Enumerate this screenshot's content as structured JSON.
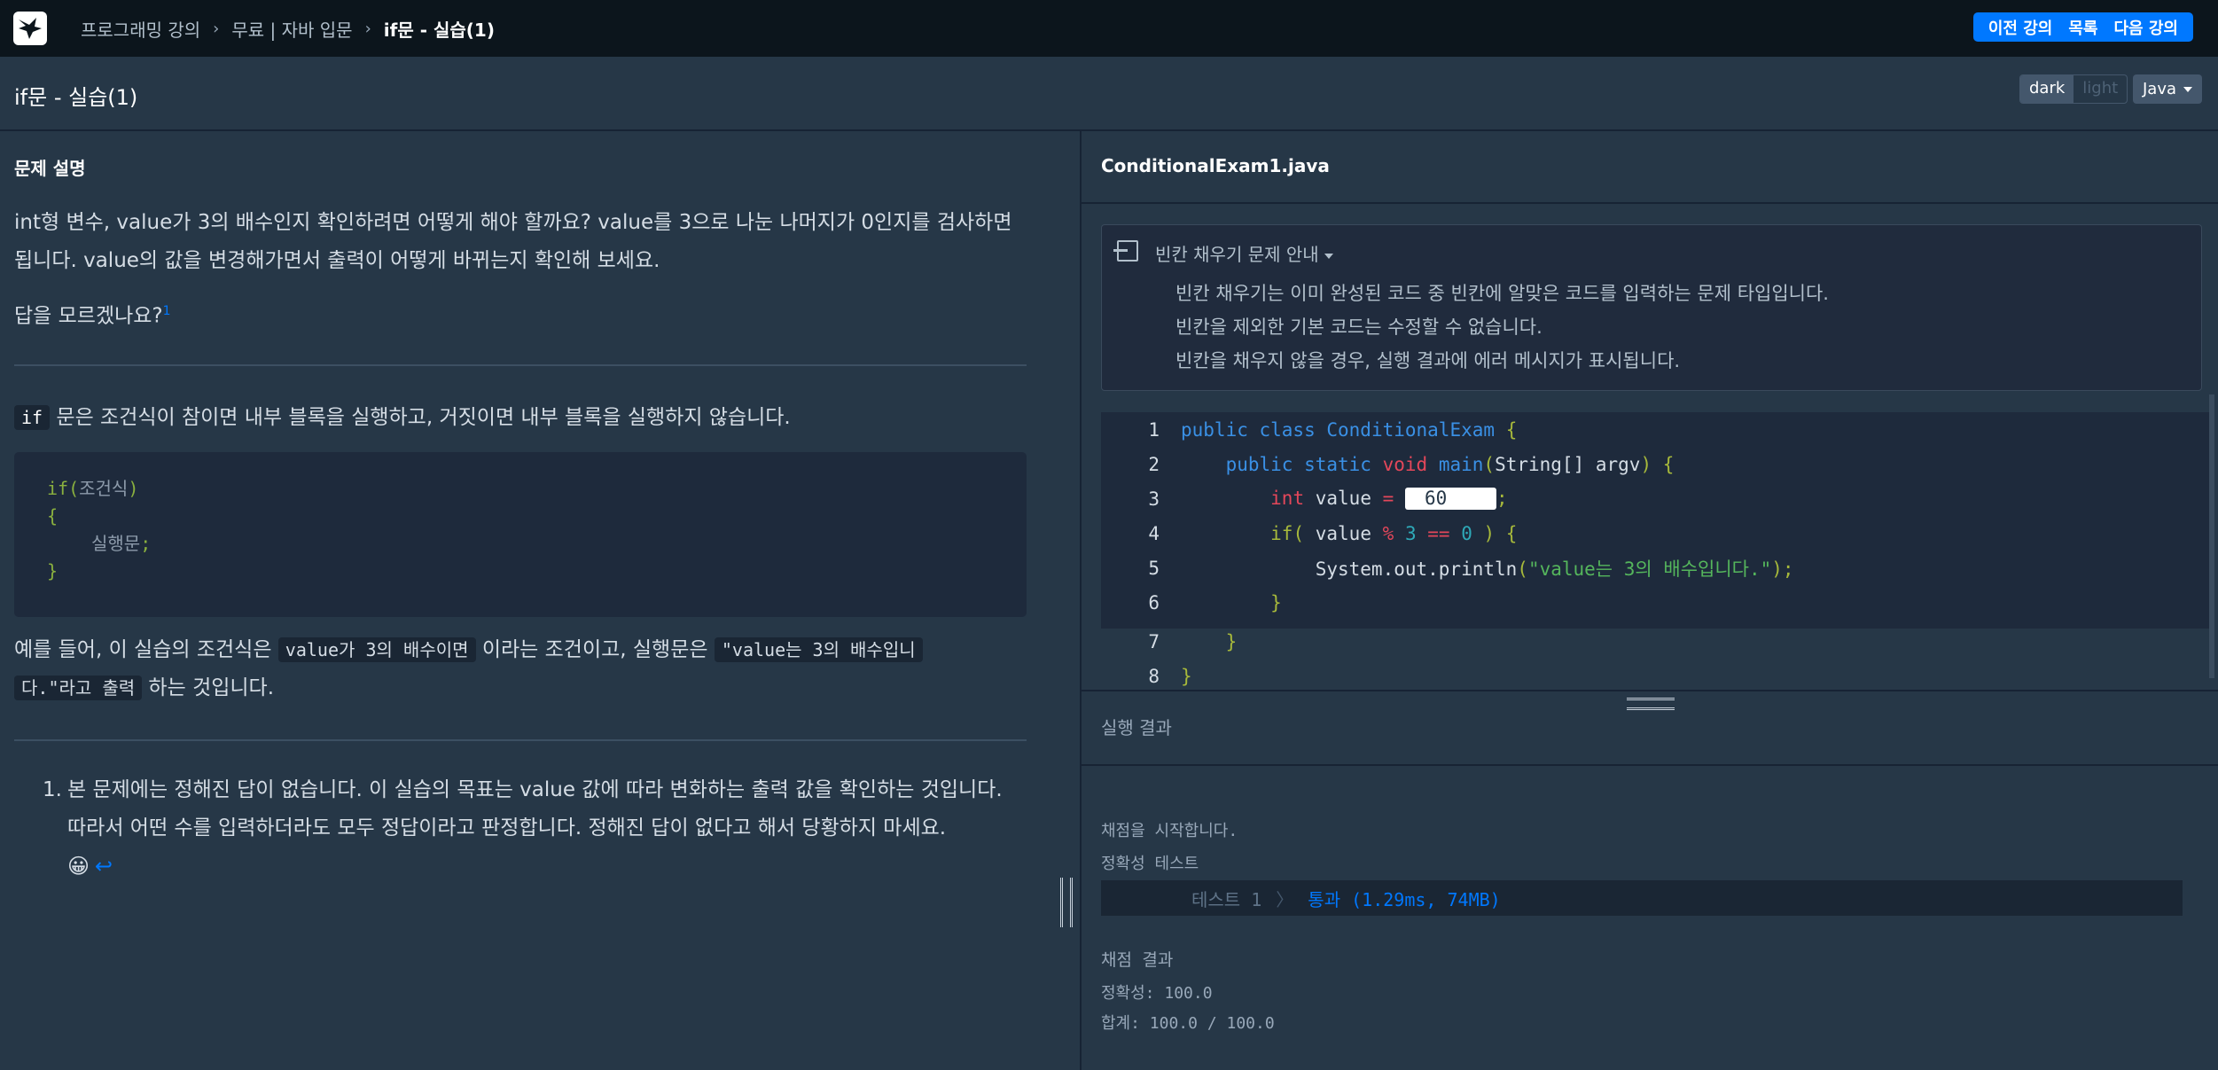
{
  "topbar": {
    "breadcrumbs": [
      "프로그래밍 강의",
      "무료 | 자바 입문"
    ],
    "current": "if문 - 실습(1)",
    "prev_label": "이전 강의",
    "list_label": "목록",
    "next_label": "다음 강의"
  },
  "titlebar": {
    "title": "if문 - 실습(1)",
    "theme_dark": "dark",
    "theme_light": "light",
    "language": "Java"
  },
  "description": {
    "heading": "문제 설명",
    "para1": "int형 변수, value가 3의 배수인지 확인하려면 어떻게 해야 할까요? value를 3으로 나눈 나머지가 0인지를 검사하면 됩니다. value의 값을 변경해가면서 출력이 어떻게 바뀌는지 확인해 보세요.",
    "para2": "답을 모르겠나요?",
    "para2_footnote": "1",
    "para3_code": "if",
    "para3_text": " 문은 조건식이 참이면 내부 블록을 실행하고, 거짓이면 내부 블록을 실행하지 않습니다.",
    "codeblock": {
      "line1_kw": "if(",
      "line1_cond": "조건식",
      "line1_close": ")",
      "line2": "{",
      "line3_stmt": "실행문",
      "line3_semi": ";",
      "line4": "}"
    },
    "para4_a": "예를 들어, 이 실습의 조건식은 ",
    "para4_code1": "value가 3의 배수이면",
    "para4_b": " 이라는 조건이고, 실행문은 ",
    "para4_code2a": "\"value는 3의 배수입니",
    "para4_code2b": "다.\"라고 출력",
    "para4_c": " 하는 것입니다.",
    "footnote_num": "1.",
    "footnote_text": "본 문제에는 정해진 답이 없습니다. 이 실습의 목표는 value 값에 따라 변화하는 출력 값을 확인하는 것입니다. 따라서 어떤 수를 입력하더라도 모두 정답이라고 판정합니다. 정해진 답이 없다고 해서 당황하지 마세요.",
    "emoji": "😀",
    "back_arrow": "↩"
  },
  "editor": {
    "filename": "ConditionalExam1.java",
    "guide_title": "빈칸 채우기 문제 안내",
    "guide_lines": [
      "빈칸 채우기는 이미 완성된 코드 중 빈칸에 알맞은 코드를 입력하는 문제 타입입니다.",
      "빈칸을 제외한 기본 코드는 수정할 수 없습니다.",
      "빈칸을 채우지 않을 경우, 실행 결과에 에러 메시지가 표시됩니다."
    ],
    "line_numbers": [
      "1",
      "2",
      "3",
      "4",
      "5",
      "6",
      "7",
      "8"
    ],
    "blank_value": "60",
    "code": {
      "l1_kw": "public class",
      "l1_name": "ConditionalExam",
      "l1_brace": "{",
      "l2_kw": "public static",
      "l2_void": "void",
      "l2_main": "main",
      "l2_args_open": "(",
      "l2_args": "String[] argv",
      "l2_args_close": ")",
      "l2_brace": "{",
      "l3_type": "int",
      "l3_var": "value",
      "l3_eq": "=",
      "l3_semi": ";",
      "l4_if": "if(",
      "l4_var": "value",
      "l4_mod": "%",
      "l4_three": "3",
      "l4_eqeq": "==",
      "l4_zero": "0",
      "l4_close": ") {",
      "l5_call": "System.out.println",
      "l5_open": "(",
      "l5_str": "\"value는 3의 배수입니다.\"",
      "l5_close": ");",
      "l6": "}",
      "l7": "}",
      "l8": "}"
    }
  },
  "result": {
    "title": "실행 결과",
    "start_msg": "채점을 시작합니다.",
    "tabs": "정확성  테스트",
    "test_label": "테스트 1",
    "test_sep": "〉",
    "test_result": "통과 (1.29ms, 74MB)",
    "summary_title": "채점 결과",
    "accuracy": "정확성: 100.0",
    "total": "합계: 100.0 / 100.0"
  }
}
